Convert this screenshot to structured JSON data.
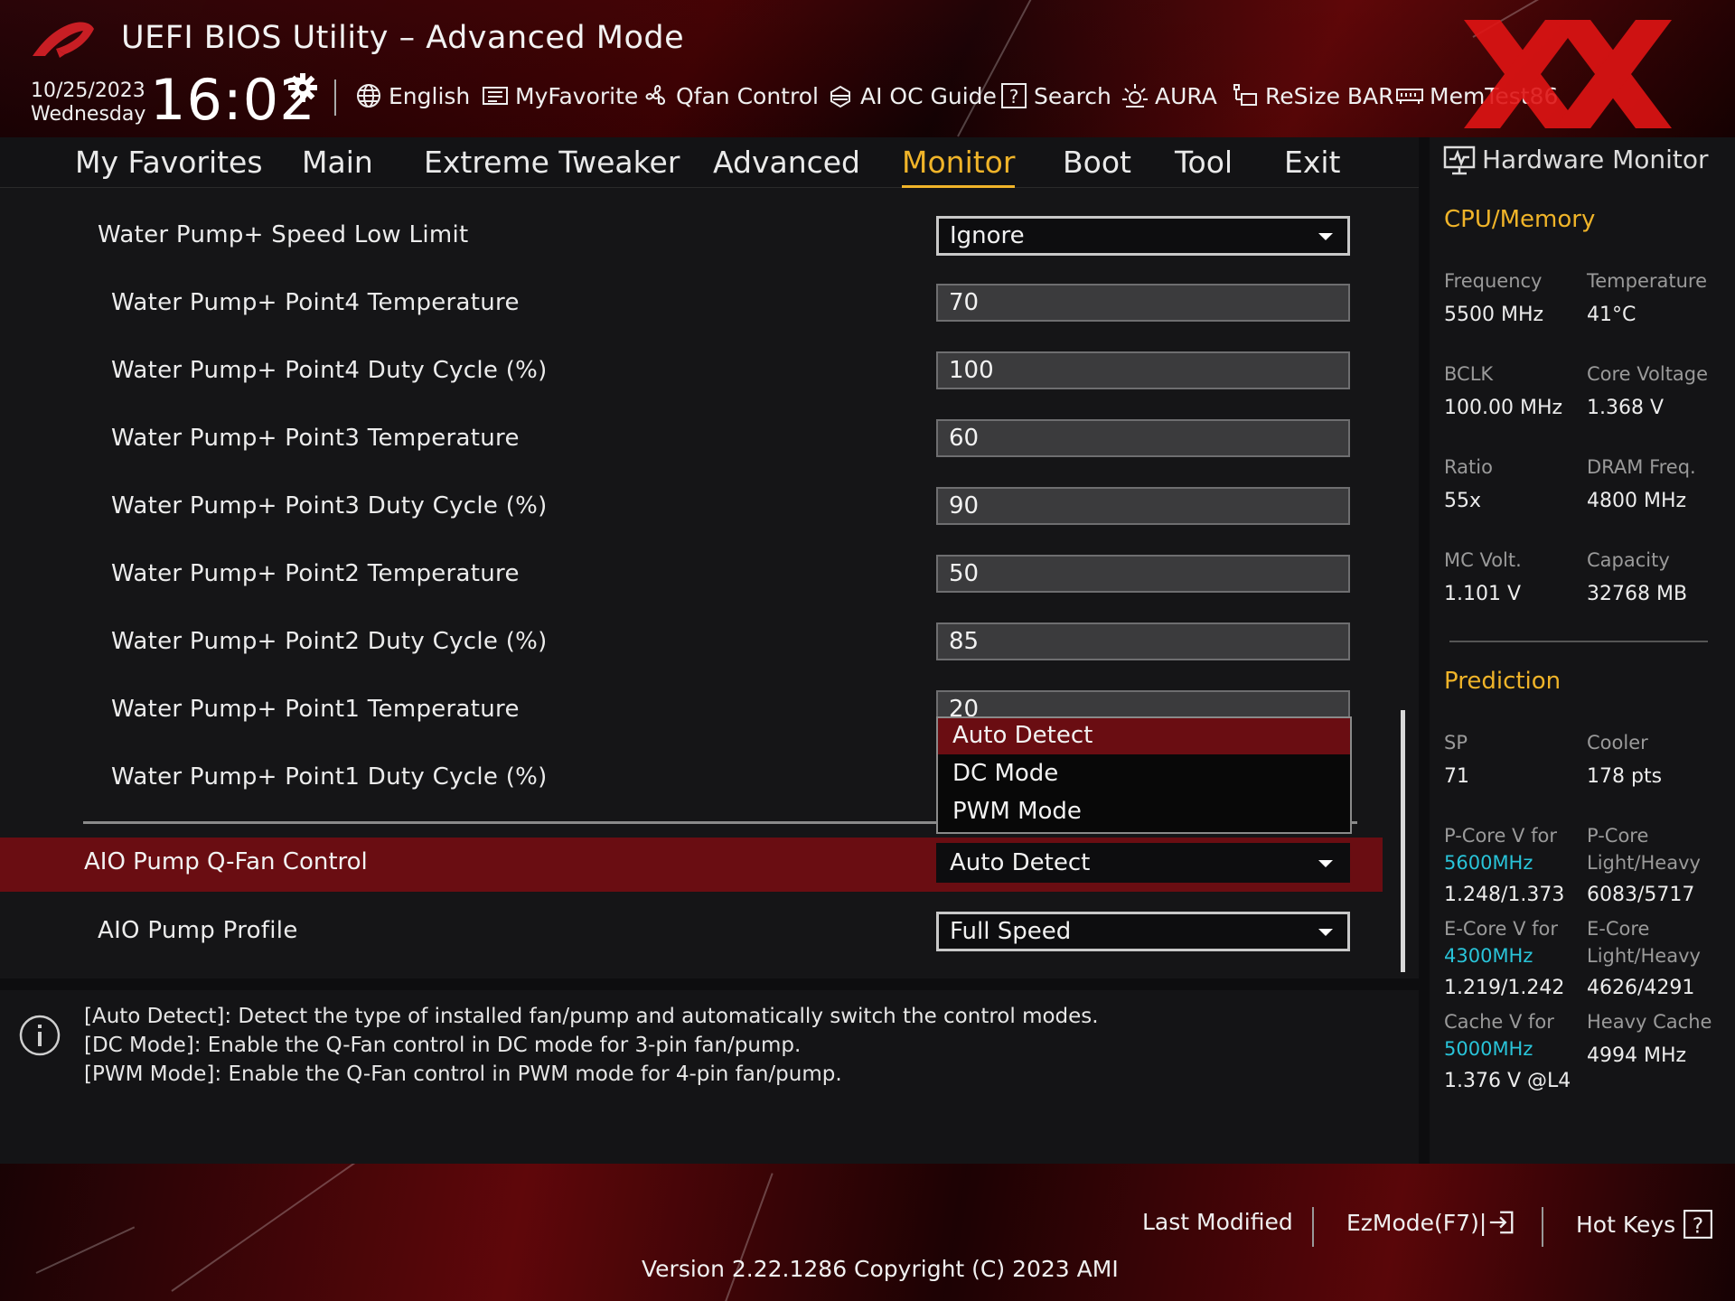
{
  "header": {
    "title": "UEFI BIOS Utility – Advanced Mode",
    "date": "10/25/2023",
    "weekday": "Wednesday",
    "time": "16:02",
    "tools": [
      {
        "label": "English",
        "icon": "globe-icon"
      },
      {
        "label": "MyFavorite",
        "icon": "favorite-icon"
      },
      {
        "label": "Qfan Control",
        "icon": "fan-icon"
      },
      {
        "label": "AI OC Guide",
        "icon": "ai-oc-icon"
      },
      {
        "label": "Search",
        "icon": "help-search-icon"
      },
      {
        "label": "AURA",
        "icon": "aura-icon"
      },
      {
        "label": "ReSize BAR",
        "icon": "resize-bar-icon"
      },
      {
        "label": "MemTest86",
        "icon": "memtest-icon"
      }
    ]
  },
  "nav": {
    "tabs": [
      "My Favorites",
      "Main",
      "Extreme Tweaker",
      "Advanced",
      "Monitor",
      "Boot",
      "Tool",
      "Exit"
    ],
    "active": "Monitor"
  },
  "settings": [
    {
      "label": "Water Pump+ Speed Low Limit",
      "type": "select",
      "value": "Ignore"
    },
    {
      "label": "Water Pump+ Point4 Temperature",
      "type": "field",
      "value": "70"
    },
    {
      "label": "Water Pump+ Point4 Duty Cycle (%)",
      "type": "field",
      "value": "100"
    },
    {
      "label": "Water Pump+ Point3 Temperature",
      "type": "field",
      "value": "60"
    },
    {
      "label": "Water Pump+ Point3 Duty Cycle (%)",
      "type": "field",
      "value": "90"
    },
    {
      "label": "Water Pump+ Point2 Temperature",
      "type": "field",
      "value": "50"
    },
    {
      "label": "Water Pump+ Point2 Duty Cycle (%)",
      "type": "field",
      "value": "85"
    },
    {
      "label": "Water Pump+ Point1 Temperature",
      "type": "field",
      "value": "20"
    },
    {
      "label": "Water Pump+ Point1 Duty Cycle (%)",
      "type": "field",
      "value": ""
    }
  ],
  "aio_control": {
    "label": "AIO Pump Q-Fan Control",
    "value": "Auto Detect"
  },
  "aio_profile": {
    "label": "AIO Pump Profile",
    "value": "Full Speed"
  },
  "dropdown": {
    "options": [
      "Auto Detect",
      "DC Mode",
      "PWM Mode"
    ],
    "selected": "Auto Detect"
  },
  "help": {
    "lines": [
      "[Auto Detect]: Detect the type of installed fan/pump and automatically switch the control modes.",
      "[DC Mode]: Enable the Q-Fan control in DC mode for 3-pin fan/pump.",
      "[PWM Mode]: Enable the Q-Fan control in PWM mode for 4-pin fan/pump."
    ]
  },
  "hw_monitor": {
    "title": "Hardware Monitor",
    "cpu_section": "CPU/Memory",
    "cpu": [
      {
        "k": "Frequency",
        "v": "5500 MHz"
      },
      {
        "k": "Temperature",
        "v": "41°C"
      },
      {
        "k": "BCLK",
        "v": "100.00 MHz"
      },
      {
        "k": "Core Voltage",
        "v": "1.368 V"
      },
      {
        "k": "Ratio",
        "v": "55x"
      },
      {
        "k": "DRAM Freq.",
        "v": "4800 MHz"
      },
      {
        "k": "MC Volt.",
        "v": "1.101 V"
      },
      {
        "k": "Capacity",
        "v": "32768 MB"
      }
    ],
    "prediction_section": "Prediction",
    "prediction": {
      "sp_label": "SP",
      "sp_value": "71",
      "cooler_label": "Cooler",
      "cooler_value": "178 pts",
      "pcore_v_label": "P-Core V for",
      "pcore_v_freq": "5600MHz",
      "pcore_v_value": "1.248/1.373",
      "pcore_lh_label1": "P-Core",
      "pcore_lh_label2": "Light/Heavy",
      "pcore_lh_value": "6083/5717",
      "ecore_v_label": "E-Core V for",
      "ecore_v_freq": "4300MHz",
      "ecore_v_value": "1.219/1.242",
      "ecore_lh_label1": "E-Core",
      "ecore_lh_label2": "Light/Heavy",
      "ecore_lh_value": "4626/4291",
      "cache_v_label": "Cache V for",
      "cache_v_freq": "5000MHz",
      "cache_v_value": "1.376 V @L4",
      "heavy_cache_label": "Heavy Cache",
      "heavy_cache_value": "4994 MHz"
    }
  },
  "footer": {
    "last_modified": "Last Modified",
    "ezmode": "EzMode(F7)|",
    "hotkeys": "Hot Keys",
    "version": "Version 2.22.1286 Copyright (C) 2023 AMI"
  },
  "colors": {
    "accent": "#f0b429",
    "highlight_row": "#6a0d12",
    "cyan": "#29c4d9",
    "watermark": "#e01414"
  }
}
